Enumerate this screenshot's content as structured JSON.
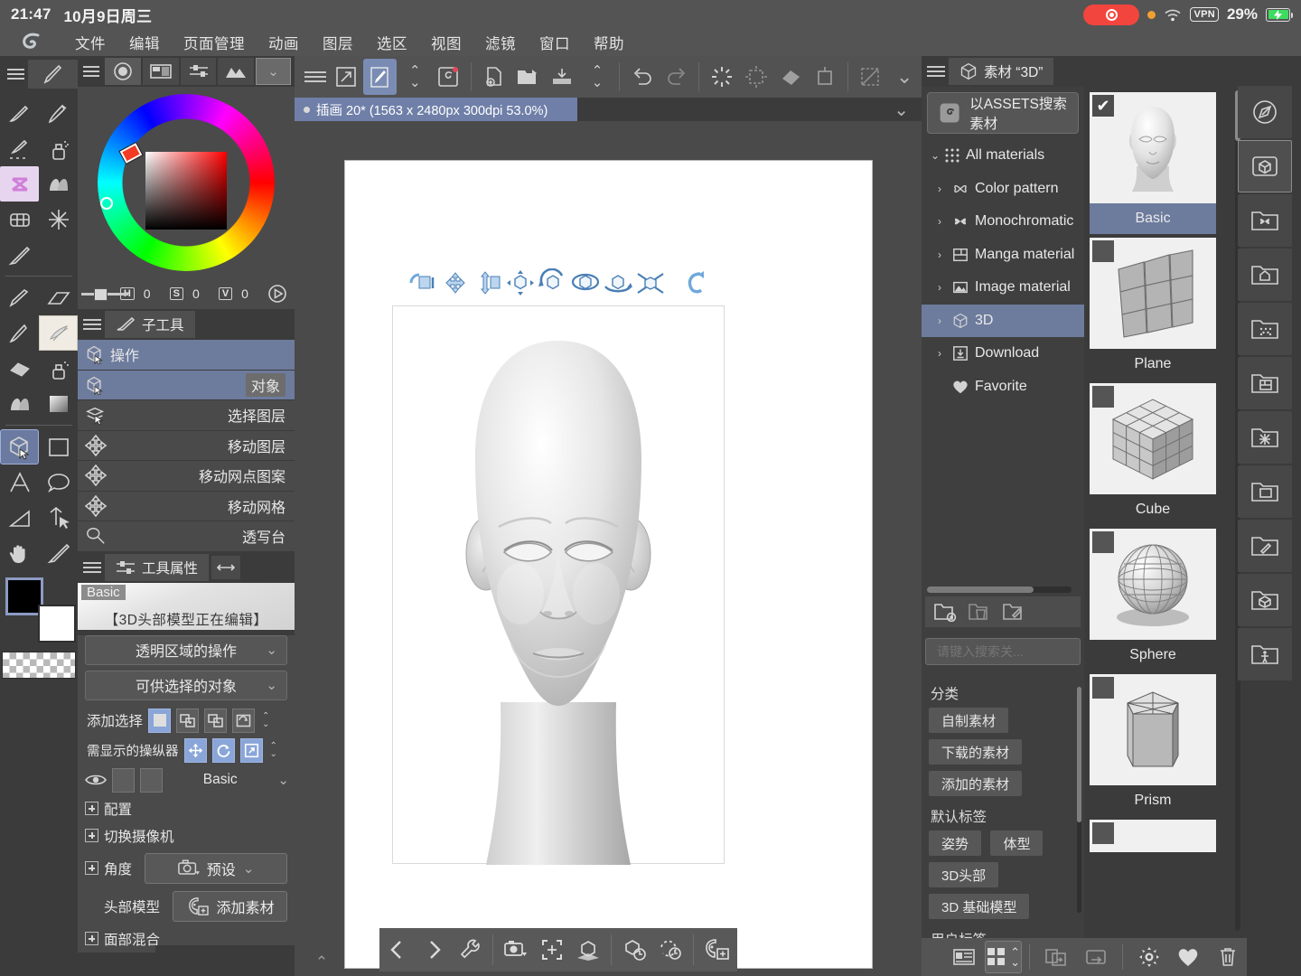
{
  "statusbar": {
    "time": "21:47",
    "date": "10月9日周三",
    "vpn": "VPN",
    "battery_pct": "29%",
    "icons": [
      "screen-record-icon",
      "orange-status-dot",
      "wifi-icon",
      "vpn-badge",
      "battery-icon"
    ]
  },
  "menubar": {
    "logo": "clip-studio-paint-logo",
    "items": [
      "文件",
      "编辑",
      "页面管理",
      "动画",
      "图层",
      "选区",
      "视图",
      "滤镜",
      "窗口",
      "帮助"
    ]
  },
  "left_rail_top": {
    "collapse": "«",
    "collapse2": "«",
    "back": "‹"
  },
  "right_rail_top": {
    "forward": "›",
    "expand": "»",
    "collapse": "«"
  },
  "toolbar_tools": {
    "top_tabs": [
      "menu-icon",
      "brush-tab-icon"
    ],
    "tools": [
      "pen-icon",
      "pencil-icon",
      "dashed-pen-icon",
      "airbrush-icon",
      "decoration-icon",
      "blend-icon",
      "mesh-icon",
      "sparkle-icon",
      "eyedropper-icon",
      "marker-icon",
      "eraser-icon",
      "pencil2-icon",
      "texture-icon",
      "fill-icon",
      "spray-icon",
      "blur-icon",
      "gradient-icon",
      "object-3d-icon",
      "rect-select-icon",
      "text-icon",
      "balloon-icon",
      "ruler-icon",
      "correction-icon",
      "hand-icon",
      "color-picker-icon"
    ],
    "foreground_color": "#000000",
    "background_color": "#ffffff",
    "transparent_label": "transparent-swatch"
  },
  "color_panel": {
    "tabs": [
      "color-wheel-tab",
      "color-set-tab",
      "color-slider-tab",
      "color-history-tab"
    ],
    "active_tab_index": 0,
    "hsv": [
      {
        "key": "H",
        "value": "0"
      },
      {
        "key": "S",
        "value": "0"
      },
      {
        "key": "V",
        "value": "0"
      }
    ]
  },
  "subtool_panel": {
    "title": "子工具",
    "title_icon": "subtool-icon",
    "items": [
      {
        "label": "操作",
        "icon": "operation-3d-icon",
        "selected": true,
        "tag": ""
      },
      {
        "label": "",
        "icon": "object-3d-icon",
        "selected": true,
        "tag": "对象"
      },
      {
        "label": "选择图层",
        "icon": "select-layer-icon",
        "selected": false,
        "tag": ""
      },
      {
        "label": "移动图层",
        "icon": "move-icon",
        "selected": false,
        "tag": ""
      },
      {
        "label": "移动网点图案",
        "icon": "move-icon",
        "selected": false,
        "tag": ""
      },
      {
        "label": "移动网格",
        "icon": "move-icon",
        "selected": false,
        "tag": ""
      },
      {
        "label": "透写台",
        "icon": "lightbox-icon",
        "selected": false,
        "tag": ""
      }
    ]
  },
  "tool_property": {
    "title": "工具属性",
    "title_icon": "tool-property-icon",
    "link_icon": "link-icon",
    "preview_badge": "Basic",
    "preview_caption": "【3D头部模型正在编辑】",
    "buttons": [
      {
        "label": "透明区域的操作",
        "chevron": "⌄"
      },
      {
        "label": "可供选择的对象",
        "chevron": "⌄"
      }
    ],
    "add_select": {
      "label": "添加选择",
      "options": [
        "new-selection-icon",
        "add-selection-icon",
        "subtract-selection-icon",
        "toggle-selection-icon"
      ],
      "active_index": 0
    },
    "manipulators": {
      "label": "需显示的操纵器",
      "options": [
        "move-manipulator-icon",
        "rotate-manipulator-icon",
        "scale-manipulator-icon"
      ],
      "all_active": true
    },
    "layer_row": {
      "eye": "eye-icon",
      "value": "Basic",
      "chevron": "⌄"
    },
    "expanders": [
      "配置",
      "切换摄像机",
      "角度",
      "面部混合"
    ],
    "angle_preset": {
      "label": "预设",
      "icon": "camera-preset-icon",
      "chevron": "⌄"
    },
    "head_model": {
      "label": "头部模型",
      "button": "添加素材",
      "icon": "add-head-material-icon"
    },
    "footer_icons": [
      "history-icon",
      "wrench-icon"
    ]
  },
  "canvas": {
    "toolbar_icons": [
      "menu-icon",
      "fullscreen-icon",
      "brush-size-icon",
      "updown-icon",
      "assets-icon",
      "new-doc-icon",
      "open-file-icon",
      "save-icon",
      "updown2-icon",
      "undo-icon",
      "redo-icon",
      "clear-icon",
      "select-all-icon",
      "fill-icon",
      "crop-icon",
      "deselect-icon",
      "chevron-down-icon"
    ],
    "active_toolbar_index": 2,
    "document_tab": "插画 20* (1563 x 2480px 300dpi 53.0%)",
    "document_chevron": "⌄",
    "manipulator_icons": [
      "move-camera-icon",
      "pan-icon",
      "move-vertical-icon",
      "move-object-icon",
      "rotate-object-icon",
      "rotate-y-icon",
      "rotate-z-icon",
      "scale-object-icon",
      "reset-icon"
    ],
    "bottom_toolbar_icons": [
      "prev-icon",
      "next-icon",
      "wrench-icon",
      "camera-preset-icon",
      "fit-screen-icon",
      "ground-icon",
      "reset-object-icon",
      "reset-rotation-icon",
      "add-head-icon"
    ],
    "bottom_expand": "⌃"
  },
  "material_panel": {
    "tab_label": "素材 “3D”",
    "tab_icon": "material-3d-icon",
    "assets_search_button": "以ASSETS搜索素材",
    "assets_icon": "assets-logo-icon",
    "tree": [
      {
        "label": "All materials",
        "icon": "grid-dots-icon",
        "arrow": "⌄",
        "level": 0,
        "selected": false
      },
      {
        "label": "Color pattern",
        "icon": "color-pattern-icon",
        "arrow": "›",
        "level": 1,
        "selected": false
      },
      {
        "label": "Monochromatic",
        "icon": "monochromatic-icon",
        "arrow": "›",
        "level": 1,
        "selected": false
      },
      {
        "label": "Manga material",
        "icon": "manga-material-icon",
        "arrow": "›",
        "level": 1,
        "selected": false
      },
      {
        "label": "Image material",
        "icon": "image-material-icon",
        "arrow": "›",
        "level": 1,
        "selected": false
      },
      {
        "label": "3D",
        "icon": "cube-3d-icon",
        "arrow": "›",
        "level": 1,
        "selected": true
      },
      {
        "label": "Download",
        "icon": "download-icon",
        "arrow": "›",
        "level": 1,
        "selected": false
      },
      {
        "label": "Favorite",
        "icon": "heart-icon",
        "arrow": "",
        "level": 1,
        "selected": false
      }
    ],
    "tree_tools": [
      "new-folder-icon",
      "delete-folder-icon",
      "edit-folder-icon"
    ],
    "search": {
      "placeholder": "请键入搜索关...",
      "icon": "search-icon",
      "clear": "✕"
    },
    "filters": [
      {
        "heading": "分类",
        "tags": [
          "自制素材",
          "下载的素材",
          "添加的素材"
        ]
      },
      {
        "heading": "默认标签",
        "tags": [
          "姿势",
          "体型",
          "3D头部",
          "3D 基础模型"
        ]
      },
      {
        "heading": "用户标签",
        "tags": []
      }
    ],
    "materials": [
      {
        "name": "Basic",
        "thumb": "head-model-thumb",
        "selected": true,
        "checked": true
      },
      {
        "name": "Plane",
        "thumb": "plane-thumb",
        "selected": false,
        "checked": false
      },
      {
        "name": "Cube",
        "thumb": "cube-thumb",
        "selected": false,
        "checked": false
      },
      {
        "name": "Sphere",
        "thumb": "sphere-thumb",
        "selected": false,
        "checked": false
      },
      {
        "name": "Prism",
        "thumb": "prism-thumb",
        "selected": false,
        "checked": false
      }
    ],
    "footer_icons": [
      "list-view-icon",
      "grid-view-icon",
      "view-size-icon",
      "paste-material-icon",
      "register-material-icon",
      "settings-icon",
      "favorite-icon",
      "delete-icon"
    ],
    "footer_active": "grid-view-icon"
  },
  "right_rail": [
    {
      "icon": "navigator-icon",
      "active": false
    },
    {
      "icon": "material-3d-folder-icon",
      "active": true
    },
    {
      "icon": "monochromatic-folder-icon",
      "active": false
    },
    {
      "icon": "home-folder-icon",
      "active": false
    },
    {
      "icon": "dots-folder-icon",
      "active": false
    },
    {
      "icon": "manga-folder-icon",
      "active": false
    },
    {
      "icon": "effect-folder-icon",
      "active": false
    },
    {
      "icon": "image-folder-icon",
      "active": false
    },
    {
      "icon": "edit-folder-icon",
      "active": false
    },
    {
      "icon": "cube-folder-icon",
      "active": false
    },
    {
      "icon": "pose-folder-icon",
      "active": false
    }
  ],
  "colors": {
    "panel_bg": "#3b3b3b",
    "panel_bg2": "#4a4a4a",
    "accent_blue": "#6d7b9d",
    "accent_light": "#8aa5d8",
    "chrome": "#545454",
    "text": "#e8e8e8"
  }
}
